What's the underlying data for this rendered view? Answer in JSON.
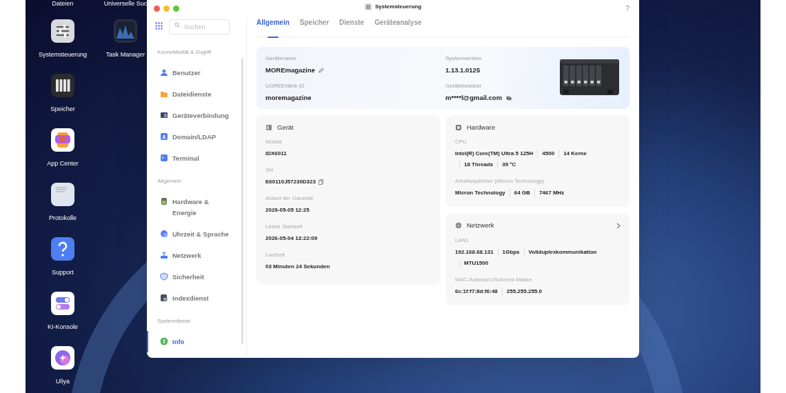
{
  "desktop": {
    "top_labels": [
      "Dateien",
      "Universelle Suc"
    ],
    "columns": [
      [
        {
          "label": "Systemsteuerung",
          "kind": "settings"
        },
        {
          "label": "Speicher",
          "kind": "storage"
        },
        {
          "label": "App Center",
          "kind": "apps"
        },
        {
          "label": "Protokolle",
          "kind": "logs"
        },
        {
          "label": "Support",
          "kind": "help"
        },
        {
          "label": "KI-Konsole",
          "kind": "toggles"
        },
        {
          "label": "Uliya",
          "kind": "assistant"
        }
      ],
      [
        {
          "label": "Task Manager",
          "kind": "monitor"
        }
      ]
    ]
  },
  "window": {
    "title": "Systemsteuerung",
    "help": "?",
    "search": {
      "placeholder": "Suchen"
    },
    "sidebar": [
      {
        "heading": "Konnektivität & Zugriff",
        "items": [
          {
            "label": "Benutzer",
            "selected": false
          },
          {
            "label": "Dateidienste",
            "selected": false
          },
          {
            "label": "Geräteverbindung",
            "selected": false
          },
          {
            "label": "Domain/LDAP",
            "selected": false
          },
          {
            "label": "Terminal",
            "selected": false
          }
        ]
      },
      {
        "heading": "Allgemein",
        "items": [
          {
            "label": "Hardware & Energie",
            "selected": false
          },
          {
            "label": "Uhrzeit & Sprache",
            "selected": false
          },
          {
            "label": "Netzwerk",
            "selected": false
          },
          {
            "label": "Sicherheit",
            "selected": false
          },
          {
            "label": "Indexdienst",
            "selected": false
          }
        ]
      },
      {
        "heading": "Systemdienst",
        "items": [
          {
            "label": "Info",
            "selected": true
          }
        ]
      }
    ],
    "tabs": [
      {
        "label": "Allgemein",
        "selected": true
      },
      {
        "label": "Speicher",
        "selected": false
      },
      {
        "label": "Dienste",
        "selected": false
      },
      {
        "label": "Geräteanalyse",
        "selected": false
      }
    ],
    "summary": [
      {
        "label": "Gerätename",
        "value": "MOREmagazine"
      },
      {
        "label": "Systemversion",
        "value": "1.13.1.0125"
      },
      {
        "label": "UGREENlink ID",
        "value": "moremagazine"
      },
      {
        "label": "Gerätebesitzer",
        "value": "m****l@gmail.com"
      }
    ],
    "cards": [
      {
        "title": "Gerät",
        "fields": [
          {
            "label": "Modell",
            "values": [
              "iDX6011"
            ]
          },
          {
            "label": "SN",
            "values": [
              "E60110J57230D323"
            ]
          },
          {
            "label": "Ablauf der Garantie",
            "values": [
              "2029-05-05 12:25"
            ]
          },
          {
            "label": "Letzte Startzeit",
            "values": [
              "2026-05-04 13:22:09"
            ]
          },
          {
            "label": "Laufzeit",
            "values": [
              "03 Minuten 24 Sekunden"
            ]
          }
        ]
      },
      {
        "title": "Hardware",
        "fields": [
          {
            "label": "CPU",
            "values": [
              "Intel(R) Core(TM) Ultra 5 125H",
              "4500",
              "14 Kerne",
              "18 Threads",
              "39 °C"
            ]
          },
          {
            "label": "Arbeitsspeicher (Micron Technology)",
            "values": [
              "Micron Technology",
              "64 GB",
              "7467 MHz"
            ]
          }
        ]
      },
      {
        "title": "Netzwerk",
        "fields": [
          {
            "label": "LAN1",
            "values": [
              "192.168.68.131",
              "1Gbps",
              "Vollduplexkommunikation",
              "MTU1500"
            ]
          },
          {
            "label": "MAC-Adresse1/Subnetz-Maske",
            "values": [
              "6c:1f:f7:8d:f6:48",
              "255.255.255.0"
            ]
          }
        ]
      }
    ]
  }
}
